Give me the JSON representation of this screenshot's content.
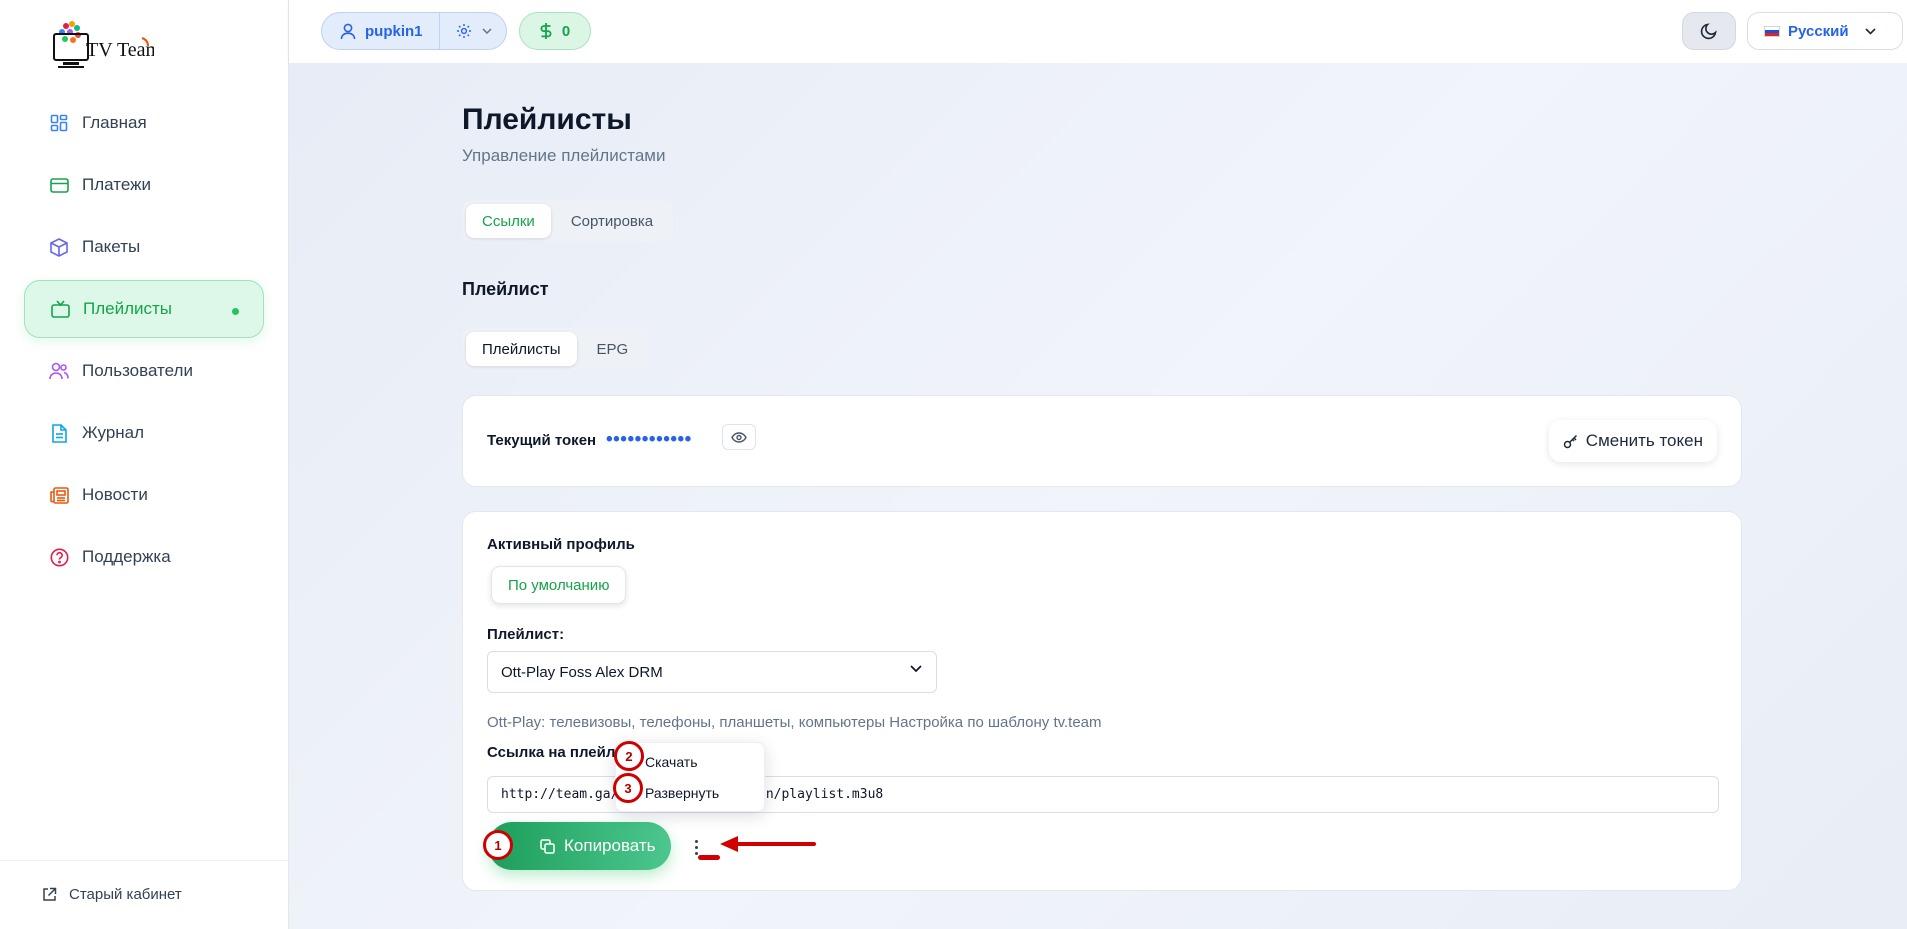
{
  "logo": {
    "text": "TV Team"
  },
  "sidebar": {
    "items": [
      {
        "label": "Главная",
        "icon": "dashboard-icon",
        "color": "#3b82f6"
      },
      {
        "label": "Платежи",
        "icon": "credit-card-icon",
        "color": "#16a34a"
      },
      {
        "label": "Пакеты",
        "icon": "package-icon",
        "color": "#6366f1"
      },
      {
        "label": "Плейлисты",
        "icon": "tv-icon",
        "color": "#16a34a",
        "active": true
      },
      {
        "label": "Пользователи",
        "icon": "users-icon",
        "color": "#a855f7"
      },
      {
        "label": "Журнал",
        "icon": "file-text-icon",
        "color": "#0ea5e9"
      },
      {
        "label": "Новости",
        "icon": "newspaper-icon",
        "color": "#ea580c"
      },
      {
        "label": "Поддержка",
        "icon": "help-circle-icon",
        "color": "#e11d48"
      }
    ],
    "old_cabinet": "Старый кабинет"
  },
  "header": {
    "username": "pupkin1",
    "balance": "0",
    "language": "Русский"
  },
  "main": {
    "title": "Плейлисты",
    "subtitle": "Управление плейлистами",
    "tabs": [
      {
        "label": "Ссылки",
        "active": true
      },
      {
        "label": "Сортировка",
        "active": false
      }
    ],
    "section_title": "Плейлист",
    "subtabs": [
      {
        "label": "Плейлисты",
        "active": true
      },
      {
        "label": "EPG",
        "active": false
      }
    ],
    "token": {
      "label": "Текущий токен",
      "masked": "••••••••••••",
      "change_label": "Сменить токен"
    },
    "active_profile_label": "Активный профиль",
    "profile_button": "По умолчанию",
    "playlist_label": "Плейлист:",
    "playlist_selected": "Ott-Play Foss Alex DRM",
    "playlist_description": "Ott-Play: телевизовы, телефоны, планшеты, компьютеры Настройка по шаблону tv.team",
    "link_label": "Ссылка на плейли",
    "link_value_start": "http://team.ga/",
    "link_value_end": "6n/playlist.m3u8",
    "copy_label": "Копировать",
    "menu": {
      "download": "Скачать",
      "expand": "Развернуть"
    }
  },
  "annotations": [
    "1",
    "2",
    "3"
  ],
  "colors": {
    "accent_green": "#16a34a",
    "accent_blue": "#2563eb",
    "annotation_red": "#d00000"
  }
}
